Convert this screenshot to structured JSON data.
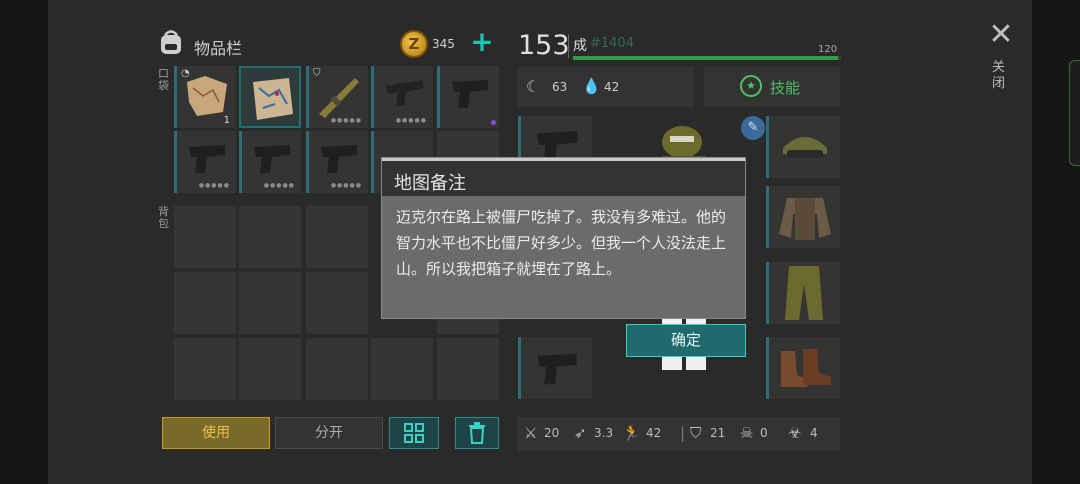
{
  "inventory": {
    "title": "物品栏",
    "pocket_label": "口袋",
    "backpack_label": "背包",
    "coins": "345",
    "coin_symbol": "Z",
    "first_item_qty": "1",
    "use_label": "使用",
    "split_label": "分开"
  },
  "character": {
    "level": "153",
    "rank": "成",
    "rank_id": "#1404",
    "xp_max": "120",
    "xp_fraction": 0.99,
    "food": "63",
    "water": "42",
    "skills_label": "技能"
  },
  "stats": {
    "attack": "20",
    "attack_speed": "3.3",
    "speed": "42",
    "armor": "21",
    "resist1": "0",
    "resist2": "4"
  },
  "close": {
    "label": "关闭"
  },
  "modal": {
    "title": "地图备注",
    "body": "迈克尔在路上被僵尸吃掉了。我没有多难过。他的智力水平也不比僵尸好多少。但我一个人没法走上山。所以我把箱子就埋在了路上。",
    "ok_label": "确定"
  }
}
